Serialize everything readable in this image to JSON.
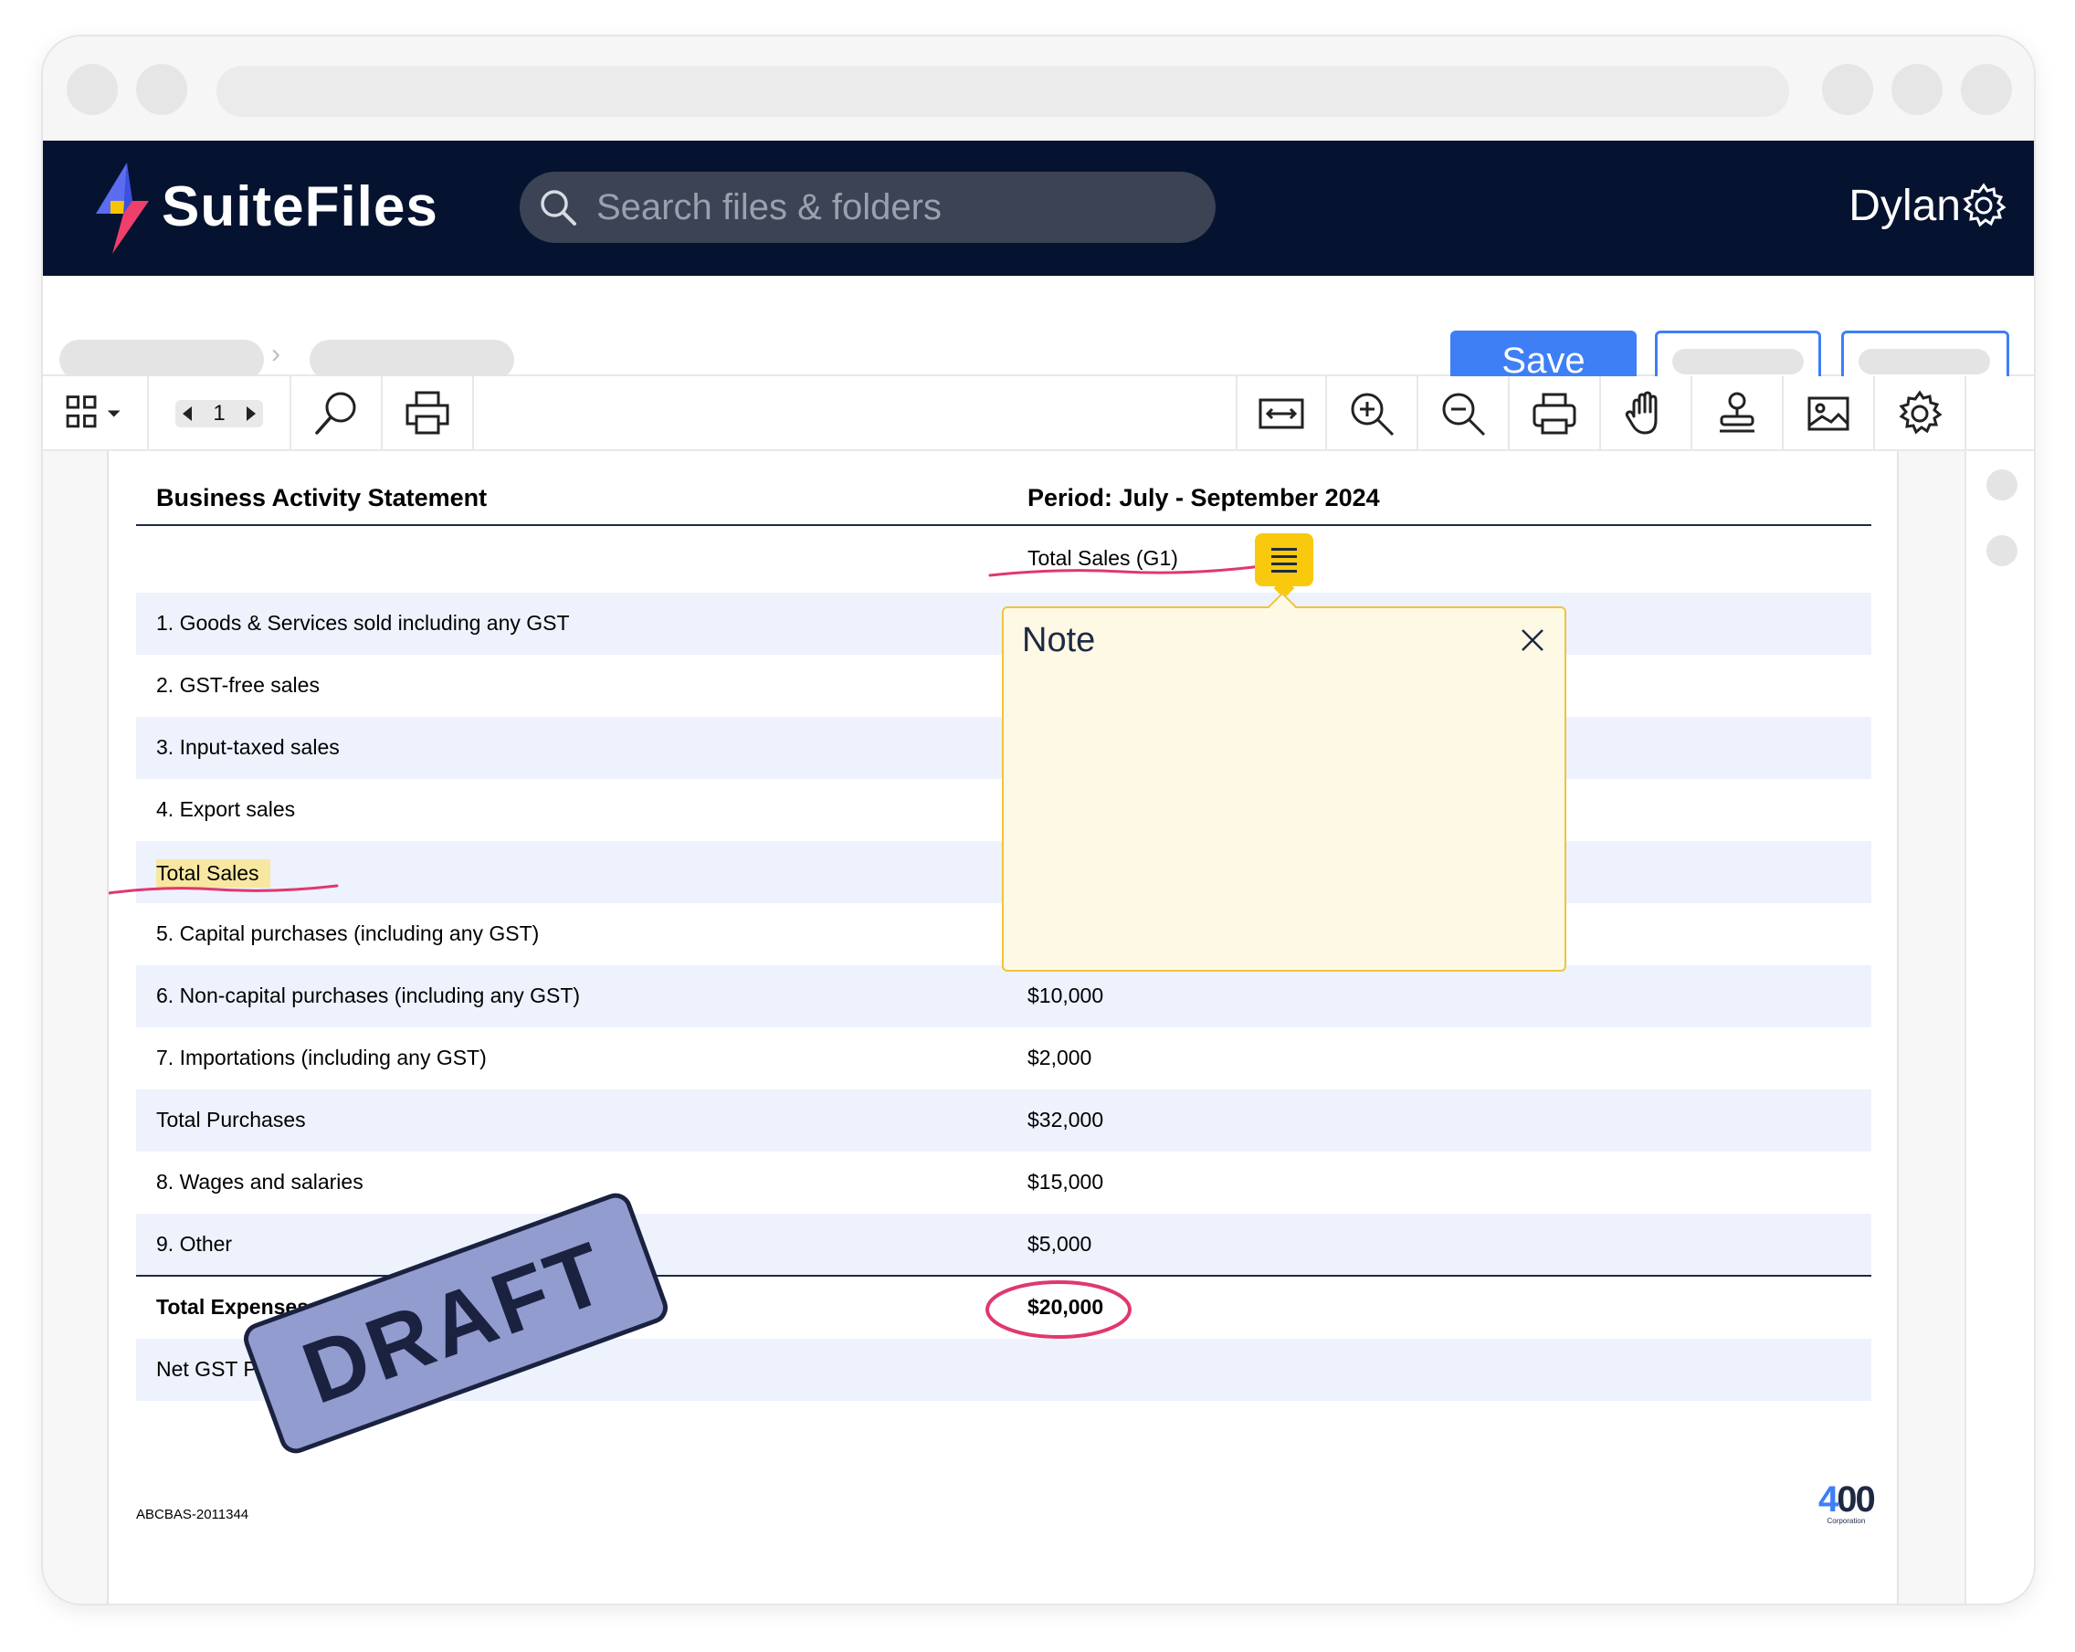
{
  "app": {
    "brand": "SuiteFiles",
    "search_placeholder": "Search files & folders",
    "user_name": "Dylan"
  },
  "actions": {
    "save_label": "Save"
  },
  "toolbar": {
    "page_number": "1"
  },
  "document": {
    "title": "Business Activity Statement",
    "period": "Period: July - September 2024",
    "column_header": "Total Sales (G1)",
    "rows": [
      {
        "label": "1. Goods & Services sold including any GST",
        "value": ""
      },
      {
        "label": "2. GST-free sales",
        "value": ""
      },
      {
        "label": "3. Input-taxed sales",
        "value": ""
      },
      {
        "label": "4. Export sales",
        "value": ""
      },
      {
        "label": "Total Sales",
        "value": ""
      },
      {
        "label": "5. Capital purchases (including any GST)",
        "value": ""
      },
      {
        "label": "6. Non-capital purchases (including any GST)",
        "value": "$10,000"
      },
      {
        "label": "7. Importations (including any GST)",
        "value": "$2,000"
      },
      {
        "label": "Total Purchases",
        "value": "$32,000"
      },
      {
        "label": "8. Wages and salaries",
        "value": "$15,000"
      },
      {
        "label": "9. Other",
        "value": "$5,000"
      },
      {
        "label": "Total Expenses",
        "value": "$20,000"
      },
      {
        "label": "Net GST Payable (1A-1B)",
        "value": ""
      }
    ],
    "footer_code": "ABCBAS-2011344",
    "corporation_logo_number": "400",
    "corporation_logo_caption": "Corporation"
  },
  "note": {
    "title": "Note"
  },
  "stamp": {
    "text": "DRAFT"
  },
  "colors": {
    "header_bg": "#051330",
    "accent": "#3e7ff5",
    "row_shade": "#edf2fd",
    "note_bg": "#fef9e4",
    "note_pin": "#f8c90d",
    "ink_markup": "#e0386c",
    "stamp_fill": "#929ccf"
  }
}
